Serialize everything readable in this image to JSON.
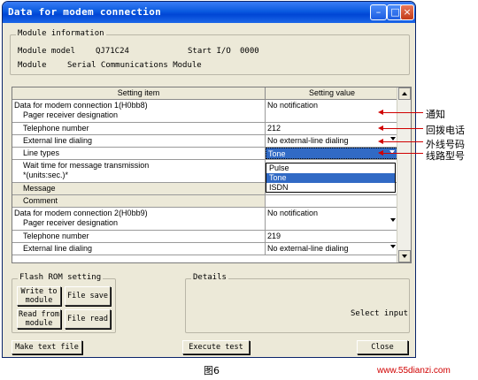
{
  "window": {
    "title": "Data for modem connection",
    "controls": [
      "minimize-icon",
      "maximize-icon",
      "close-icon"
    ]
  },
  "module_info": {
    "group_title": "Module information",
    "model_label": "Module model",
    "model_value": "QJ71C24",
    "start_io_label": "Start I/O",
    "start_io_value": "0000",
    "module_label": "Module",
    "module_value": "Serial Communications Module"
  },
  "grid": {
    "headers": [
      "Setting item",
      "Setting value"
    ],
    "rows": [
      {
        "item1": "Data for modem connection 1(H0bb8)",
        "item2": "Pager receiver designation",
        "value": "No notification",
        "dropdown": true
      },
      {
        "item1": "Telephone number",
        "value": "212"
      },
      {
        "item1": "External line dialing",
        "value": "No external-line dialing",
        "dropdown": true
      },
      {
        "item1": "Line types",
        "value": "Tone",
        "dropdown": true,
        "selected": true
      },
      {
        "item1": "Wait time for message transmission",
        "item2": "*(units:sec.)*",
        "value": ""
      },
      {
        "item1": "Message",
        "value": "",
        "gray": true
      },
      {
        "item1": "Comment",
        "value": "",
        "gray": true
      },
      {
        "item1": "Data for modem connection 2(H0bb9)",
        "item2": "Pager receiver designation",
        "value": "No notification",
        "dropdown": true
      },
      {
        "item1": "Telephone number",
        "value": "219"
      },
      {
        "item1": "External line dialing",
        "value": "No external-line dialing",
        "dropdown": true
      }
    ],
    "line_type_options": [
      "Pulse",
      "Tone",
      "ISDN"
    ],
    "line_type_selected": "Tone"
  },
  "flash_rom": {
    "group_title": "Flash ROM setting",
    "write_label": "Write to module",
    "file_save_label": "File save",
    "read_label": "Read from module",
    "file_read_label": "File read"
  },
  "details": {
    "group_title": "Details",
    "text": "Select input"
  },
  "bottom": {
    "make_text_file": "Make text file",
    "execute_test": "Execute test",
    "close": "Close"
  },
  "annotations": [
    "通知",
    "回拨电话",
    "外线号码",
    "线路型号"
  ],
  "caption": "图6",
  "site": "www.55dianzi.com",
  "colors": {
    "accent": "#d00000",
    "title_bar": "#0a5ae0",
    "selection": "#316ac5"
  }
}
